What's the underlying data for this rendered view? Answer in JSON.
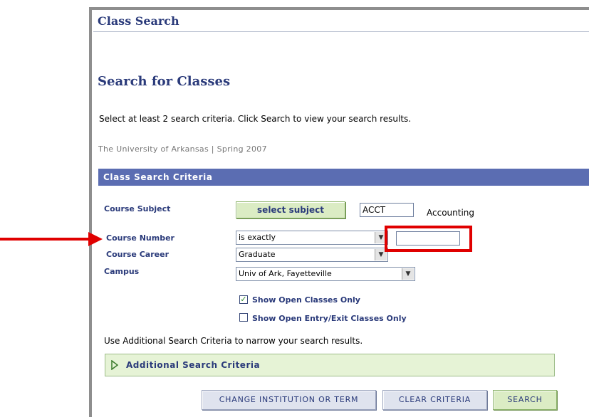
{
  "page": {
    "section_title": "Class Search",
    "heading": "Search for Classes",
    "instructions": "Select at least 2 search criteria. Click Search to view your search results.",
    "institution_term": "The University of Arkansas | Spring 2007"
  },
  "criteria": {
    "header": "Class Search Criteria",
    "course_subject_label": "Course Subject",
    "select_subject_label": "select subject",
    "subject_value": "ACCT",
    "subject_desc": "Accounting",
    "course_number_label": "Course Number",
    "course_number_operator": "is exactly",
    "course_number_value": "",
    "course_career_label": "Course Career",
    "course_career_value": "Graduate",
    "campus_label": "Campus",
    "campus_value": "Univ of Ark, Fayetteville",
    "open_only_label": "Show Open Classes Only",
    "open_only_checked": true,
    "open_entry_label": "Show Open Entry/Exit Classes Only",
    "open_entry_checked": false,
    "additional_hint": "Use Additional Search Criteria to narrow your search results.",
    "additional_label": "Additional Search Criteria"
  },
  "buttons": {
    "change_institution": "Change Institution or Term",
    "clear_criteria": "Clear Criteria",
    "search": "Search"
  },
  "colors": {
    "annotation_red": "#e00000",
    "header_blue": "#5b6db2",
    "title_navy": "#2a3a7a",
    "green_button": "#dbecc4"
  },
  "icons": {
    "dropdown": "chevron-down-icon",
    "expand": "triangle-right-icon",
    "annotation": "arrow-right-icon"
  }
}
